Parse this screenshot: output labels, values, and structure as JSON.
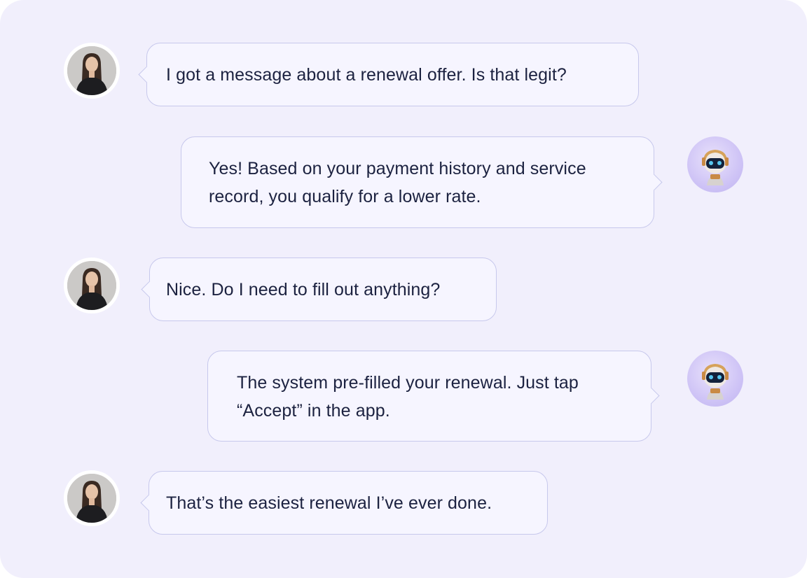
{
  "conversation": {
    "messages": [
      {
        "sender": "user",
        "avatar": "user-photo",
        "text": "I got a message about a renewal offer. Is that legit?"
      },
      {
        "sender": "assistant",
        "avatar": "robot-icon",
        "text": "Yes! Based on your payment history and service record, you qualify for a lower rate."
      },
      {
        "sender": "user",
        "avatar": "user-photo",
        "text": "Nice. Do I need to fill out anything?"
      },
      {
        "sender": "assistant",
        "avatar": "robot-icon",
        "text": "The system pre-filled your renewal. Just tap “Accept” in the app."
      },
      {
        "sender": "user",
        "avatar": "user-photo",
        "text": "That’s the easiest renewal I’ve ever done."
      }
    ]
  },
  "colors": {
    "panel_background": "#f1effc",
    "bubble_background": "#f6f5ff",
    "bubble_border": "#c7c8ec",
    "text": "#1c2240"
  }
}
